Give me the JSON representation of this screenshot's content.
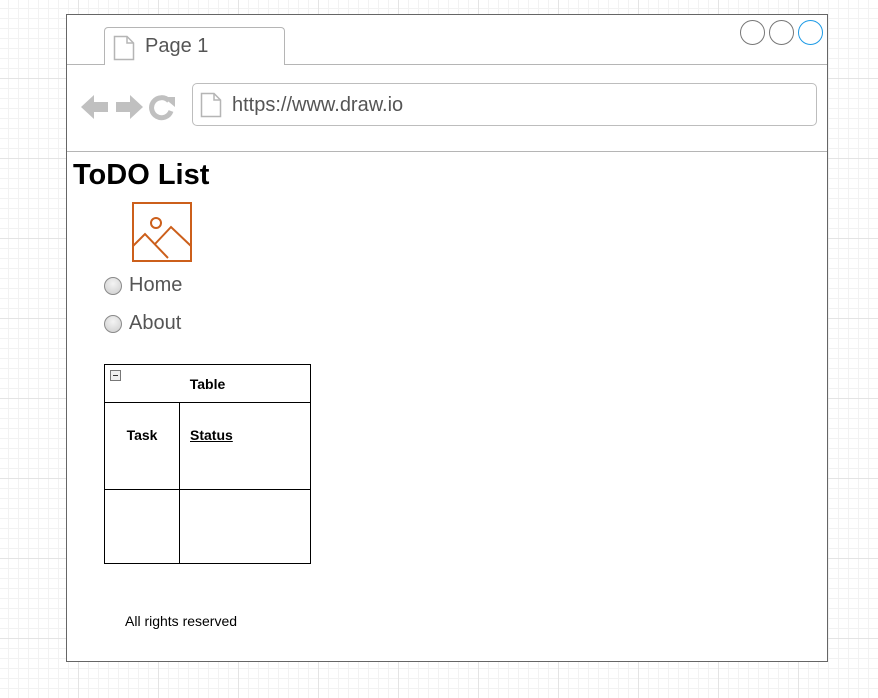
{
  "browser": {
    "tab_label": "Page 1",
    "url": "https://www.draw.io",
    "colors": {
      "frame_border": "#666666",
      "control_active": "#1e9be6",
      "nav_icon": "#c0c0c0"
    },
    "icons": [
      "page-doc-icon",
      "back-arrow-icon",
      "forward-arrow-icon",
      "reload-icon"
    ]
  },
  "page": {
    "title": "ToDO List",
    "image_icon": "image-placeholder-icon",
    "image_icon_color": "#cc5f1b",
    "nav_options": [
      {
        "label": "Home",
        "selected": false
      },
      {
        "label": "About",
        "selected": false
      }
    ],
    "table": {
      "title": "Table",
      "columns": [
        "Task",
        "Status"
      ],
      "rows": [
        [
          "",
          ""
        ]
      ]
    },
    "footer": "All rights reserved"
  }
}
